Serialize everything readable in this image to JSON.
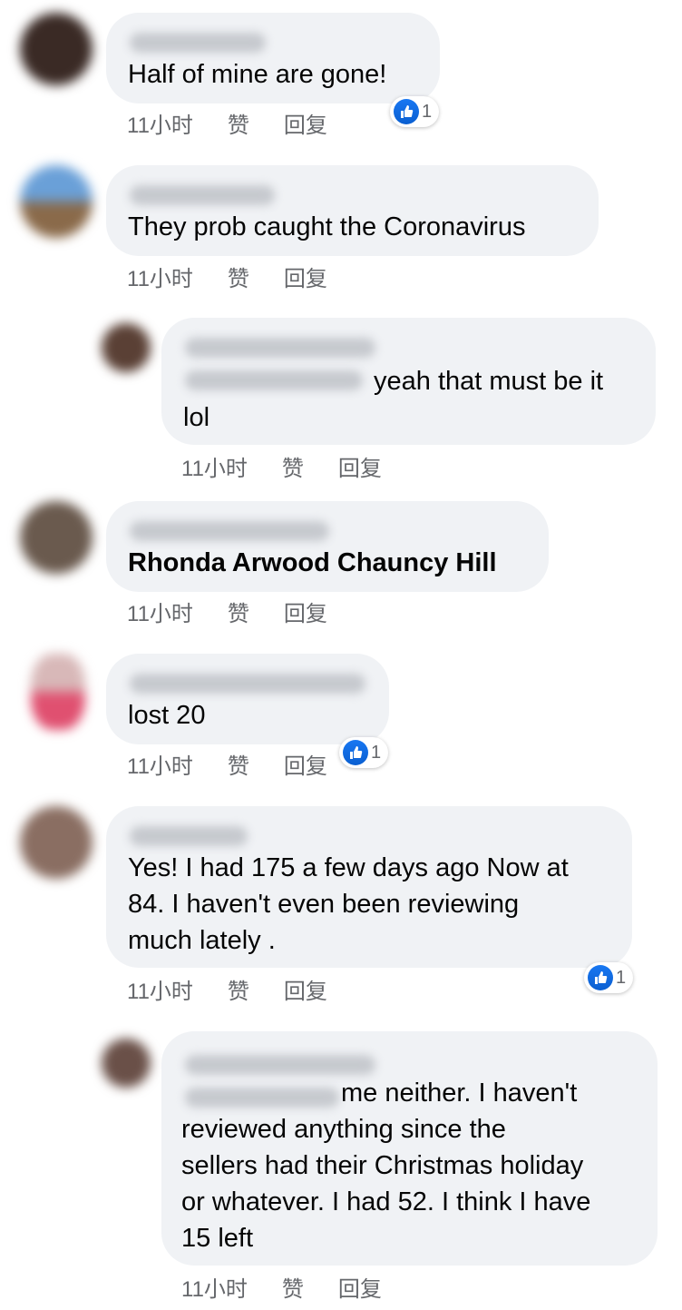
{
  "actions": {
    "like": "赞",
    "reply": "回复"
  },
  "colors": {
    "bubble": "#f0f2f5",
    "meta_text": "#65676b",
    "like_blue": "#1877f2"
  },
  "comments": [
    {
      "text": "Half of mine are gone!",
      "time": "11小时",
      "reactions": "1"
    },
    {
      "text": "They prob caught the Coronavirus",
      "time": "11小时"
    },
    {
      "text": "yeah that must be it\nlol",
      "time": "11小时"
    },
    {
      "text": "Rhonda Arwood Chauncy Hill",
      "time": "11小时"
    },
    {
      "text": "lost 20",
      "time": "11小时",
      "reactions": "1"
    },
    {
      "text": "Yes! I had 175 a few days ago Now at\n84. I haven't even been reviewing\nmuch lately .",
      "time": "11小时",
      "reactions": "1"
    },
    {
      "text": "me neither. I haven't\nreviewed anything since the\nsellers had their Christmas holiday\nor whatever. I had 52. I think I have\n15 left",
      "time": "11小时"
    }
  ]
}
